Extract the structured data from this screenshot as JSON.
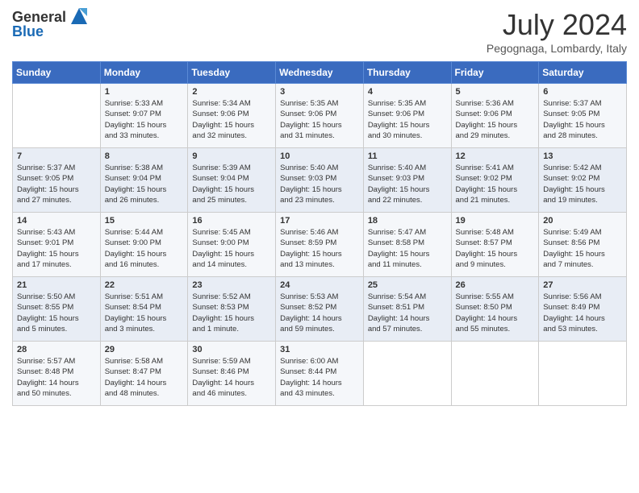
{
  "logo": {
    "text_general": "General",
    "text_blue": "Blue",
    "alt": "GeneralBlue logo"
  },
  "title": {
    "month_year": "July 2024",
    "location": "Pegognaga, Lombardy, Italy"
  },
  "headers": [
    "Sunday",
    "Monday",
    "Tuesday",
    "Wednesday",
    "Thursday",
    "Friday",
    "Saturday"
  ],
  "weeks": [
    [
      {
        "day": "",
        "info": ""
      },
      {
        "day": "1",
        "info": "Sunrise: 5:33 AM\nSunset: 9:07 PM\nDaylight: 15 hours\nand 33 minutes."
      },
      {
        "day": "2",
        "info": "Sunrise: 5:34 AM\nSunset: 9:06 PM\nDaylight: 15 hours\nand 32 minutes."
      },
      {
        "day": "3",
        "info": "Sunrise: 5:35 AM\nSunset: 9:06 PM\nDaylight: 15 hours\nand 31 minutes."
      },
      {
        "day": "4",
        "info": "Sunrise: 5:35 AM\nSunset: 9:06 PM\nDaylight: 15 hours\nand 30 minutes."
      },
      {
        "day": "5",
        "info": "Sunrise: 5:36 AM\nSunset: 9:06 PM\nDaylight: 15 hours\nand 29 minutes."
      },
      {
        "day": "6",
        "info": "Sunrise: 5:37 AM\nSunset: 9:05 PM\nDaylight: 15 hours\nand 28 minutes."
      }
    ],
    [
      {
        "day": "7",
        "info": "Sunrise: 5:37 AM\nSunset: 9:05 PM\nDaylight: 15 hours\nand 27 minutes."
      },
      {
        "day": "8",
        "info": "Sunrise: 5:38 AM\nSunset: 9:04 PM\nDaylight: 15 hours\nand 26 minutes."
      },
      {
        "day": "9",
        "info": "Sunrise: 5:39 AM\nSunset: 9:04 PM\nDaylight: 15 hours\nand 25 minutes."
      },
      {
        "day": "10",
        "info": "Sunrise: 5:40 AM\nSunset: 9:03 PM\nDaylight: 15 hours\nand 23 minutes."
      },
      {
        "day": "11",
        "info": "Sunrise: 5:40 AM\nSunset: 9:03 PM\nDaylight: 15 hours\nand 22 minutes."
      },
      {
        "day": "12",
        "info": "Sunrise: 5:41 AM\nSunset: 9:02 PM\nDaylight: 15 hours\nand 21 minutes."
      },
      {
        "day": "13",
        "info": "Sunrise: 5:42 AM\nSunset: 9:02 PM\nDaylight: 15 hours\nand 19 minutes."
      }
    ],
    [
      {
        "day": "14",
        "info": "Sunrise: 5:43 AM\nSunset: 9:01 PM\nDaylight: 15 hours\nand 17 minutes."
      },
      {
        "day": "15",
        "info": "Sunrise: 5:44 AM\nSunset: 9:00 PM\nDaylight: 15 hours\nand 16 minutes."
      },
      {
        "day": "16",
        "info": "Sunrise: 5:45 AM\nSunset: 9:00 PM\nDaylight: 15 hours\nand 14 minutes."
      },
      {
        "day": "17",
        "info": "Sunrise: 5:46 AM\nSunset: 8:59 PM\nDaylight: 15 hours\nand 13 minutes."
      },
      {
        "day": "18",
        "info": "Sunrise: 5:47 AM\nSunset: 8:58 PM\nDaylight: 15 hours\nand 11 minutes."
      },
      {
        "day": "19",
        "info": "Sunrise: 5:48 AM\nSunset: 8:57 PM\nDaylight: 15 hours\nand 9 minutes."
      },
      {
        "day": "20",
        "info": "Sunrise: 5:49 AM\nSunset: 8:56 PM\nDaylight: 15 hours\nand 7 minutes."
      }
    ],
    [
      {
        "day": "21",
        "info": "Sunrise: 5:50 AM\nSunset: 8:55 PM\nDaylight: 15 hours\nand 5 minutes."
      },
      {
        "day": "22",
        "info": "Sunrise: 5:51 AM\nSunset: 8:54 PM\nDaylight: 15 hours\nand 3 minutes."
      },
      {
        "day": "23",
        "info": "Sunrise: 5:52 AM\nSunset: 8:53 PM\nDaylight: 15 hours\nand 1 minute."
      },
      {
        "day": "24",
        "info": "Sunrise: 5:53 AM\nSunset: 8:52 PM\nDaylight: 14 hours\nand 59 minutes."
      },
      {
        "day": "25",
        "info": "Sunrise: 5:54 AM\nSunset: 8:51 PM\nDaylight: 14 hours\nand 57 minutes."
      },
      {
        "day": "26",
        "info": "Sunrise: 5:55 AM\nSunset: 8:50 PM\nDaylight: 14 hours\nand 55 minutes."
      },
      {
        "day": "27",
        "info": "Sunrise: 5:56 AM\nSunset: 8:49 PM\nDaylight: 14 hours\nand 53 minutes."
      }
    ],
    [
      {
        "day": "28",
        "info": "Sunrise: 5:57 AM\nSunset: 8:48 PM\nDaylight: 14 hours\nand 50 minutes."
      },
      {
        "day": "29",
        "info": "Sunrise: 5:58 AM\nSunset: 8:47 PM\nDaylight: 14 hours\nand 48 minutes."
      },
      {
        "day": "30",
        "info": "Sunrise: 5:59 AM\nSunset: 8:46 PM\nDaylight: 14 hours\nand 46 minutes."
      },
      {
        "day": "31",
        "info": "Sunrise: 6:00 AM\nSunset: 8:44 PM\nDaylight: 14 hours\nand 43 minutes."
      },
      {
        "day": "",
        "info": ""
      },
      {
        "day": "",
        "info": ""
      },
      {
        "day": "",
        "info": ""
      }
    ]
  ]
}
